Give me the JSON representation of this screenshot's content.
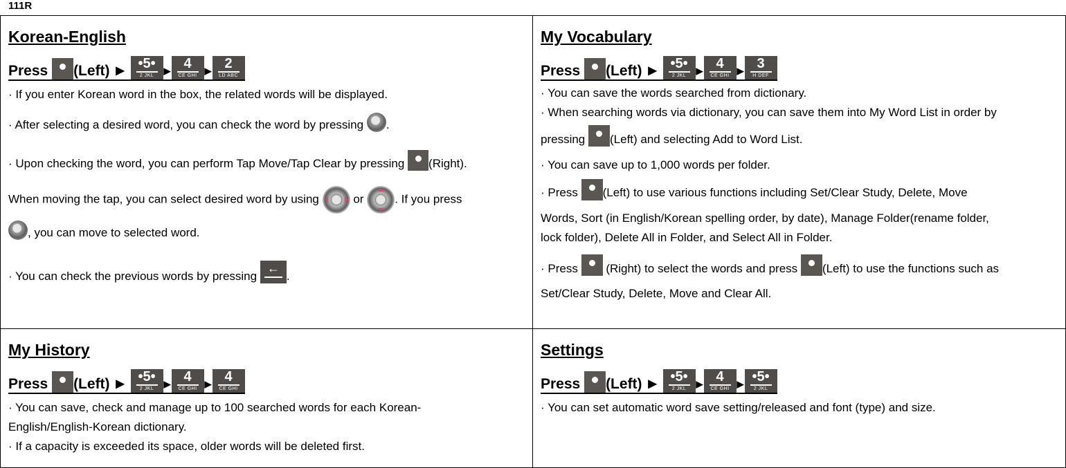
{
  "doc_id": "111R",
  "common": {
    "press_label": "Press",
    "left_label": "(Left)",
    "right_label": "(Right)."
  },
  "keys": {
    "key5": {
      "digit": "•5•",
      "sub": "2 JKL"
    },
    "key4": {
      "digit": "4",
      "sub": "CE GHI"
    },
    "key2": {
      "digit": "2",
      "sub": "LD ABC"
    },
    "key3": {
      "digit": "3",
      "sub": "H DEF"
    },
    "back": {
      "glyph": "←"
    }
  },
  "sections": {
    "korean_english": {
      "title": "Korean-English",
      "bullets": {
        "b1": "· If you enter Korean word in the box, the related words will be displayed.",
        "b2": "· After selecting a desired word, you can check the word by pressing",
        "b2_end": ".",
        "b3": "· Upon checking the word, you can perform Tap Move/Tap Clear by pressing",
        "b3_end": "(Right).",
        "b4a": "When moving the tap, you can select desired word by using",
        "b4_or": "or",
        "b4b": ". If you press",
        "b4c": ", you can move to selected word.",
        "b5": "· You can check the previous words by pressing",
        "b5_end": "."
      }
    },
    "my_vocabulary": {
      "title": "My Vocabulary",
      "bullets": {
        "b1": "· You can save the words searched from dictionary.",
        "b2": "· When searching words via dictionary, you can save them into My Word List in order by",
        "b2b": "pressing",
        "b2c": "(Left) and selecting Add to Word List.",
        "b3": "· You can save up to 1,000 words per folder.",
        "b4a": "· Press",
        "b4b": "(Left) to use various functions including Set/Clear Study, Delete, Move",
        "b4c": "Words, Sort (in English/Korean spelling order, by date), Manage Folder(rename folder,",
        "b4d": "lock folder), Delete All in Folder, and Select All in Folder.",
        "b5a": "· Press",
        "b5b": "(Right) to select the words and press",
        "b5c": "(Left) to use the functions such as",
        "b5d": "Set/Clear Study, Delete, Move and Clear All."
      }
    },
    "my_history": {
      "title": "My History",
      "bullets": {
        "b1": "· You can save, check and manage up to 100 searched words for each Korean-",
        "b1b": "English/English-Korean dictionary.",
        "b2": "· If a capacity is exceeded its space, older words will be deleted first."
      }
    },
    "settings": {
      "title": "Settings",
      "bullets": {
        "b1": "· You can set automatic word save setting/released and font (type) and size."
      }
    }
  }
}
